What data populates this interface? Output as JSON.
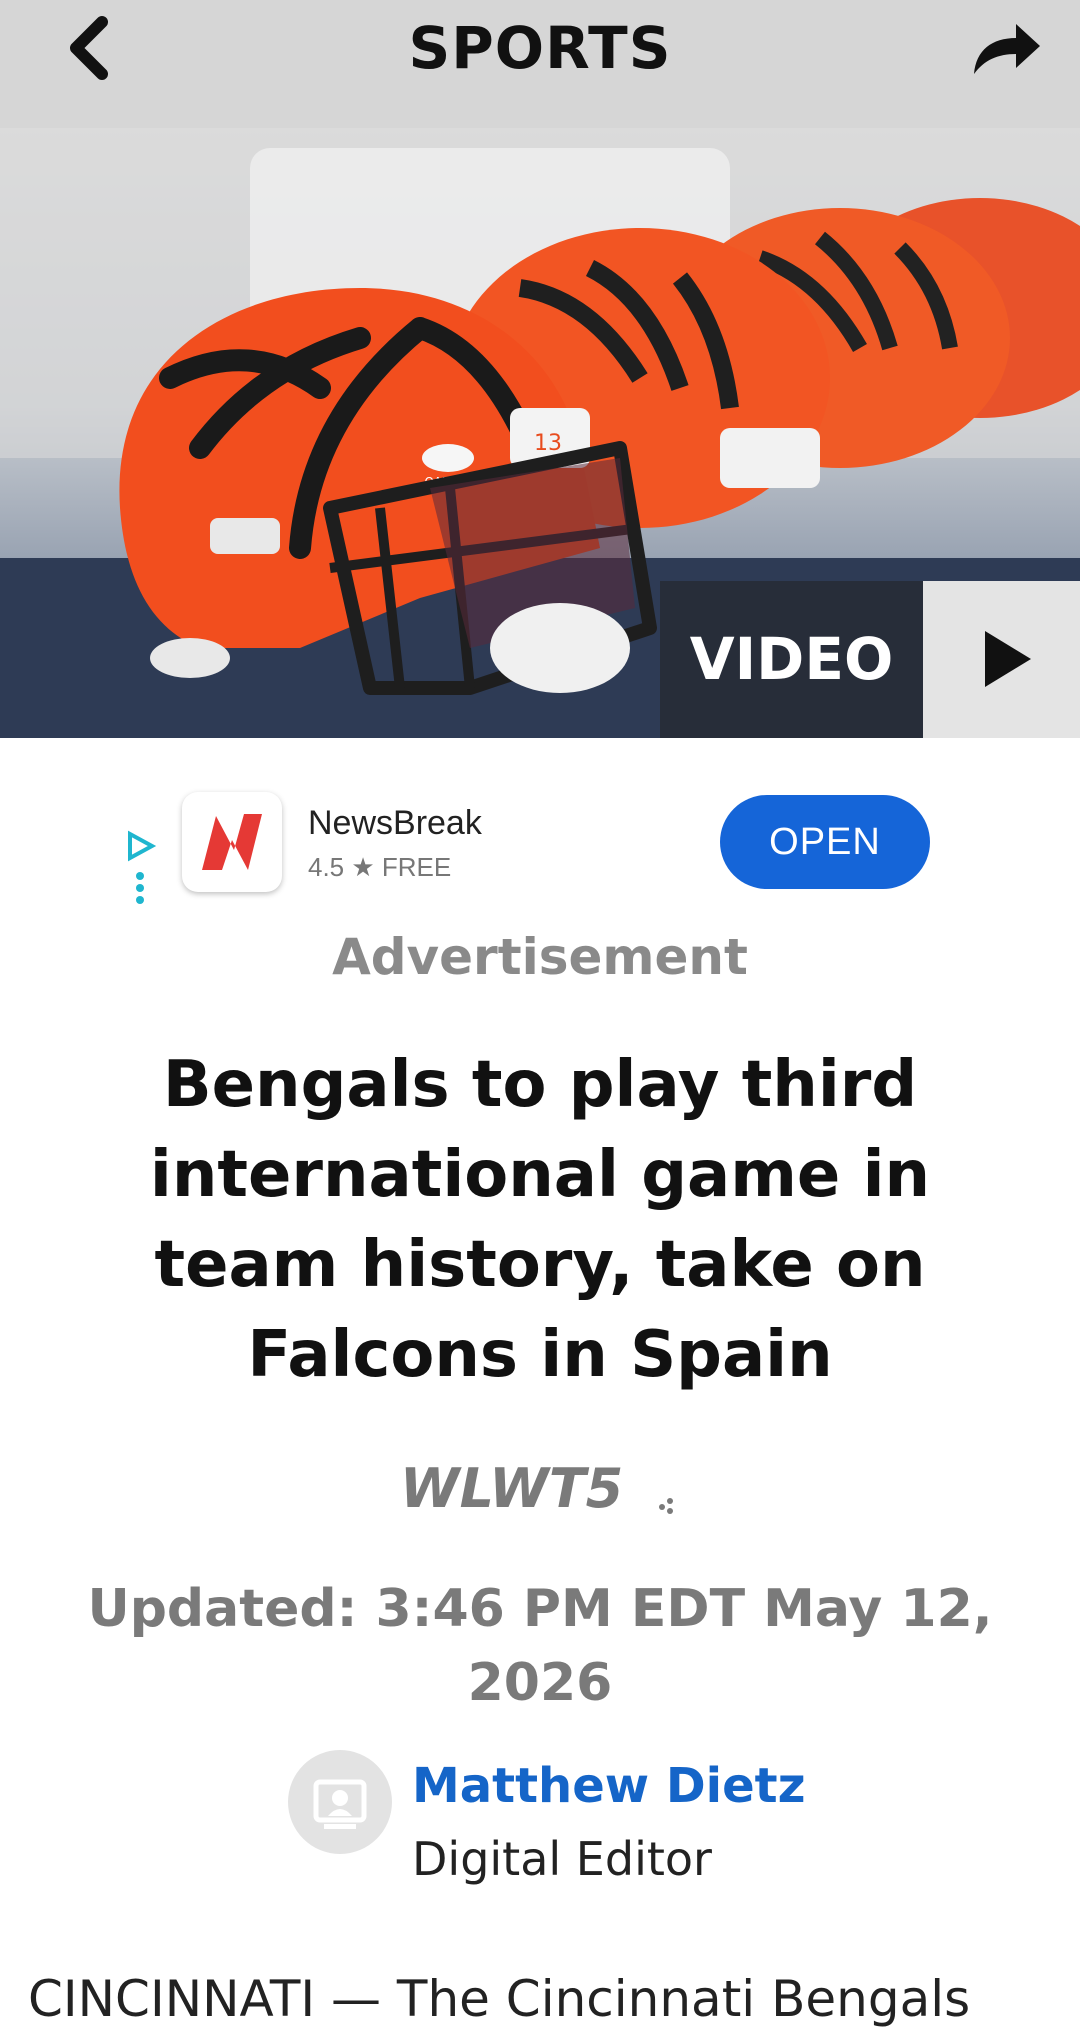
{
  "header": {
    "title": "SPORTS",
    "back_icon": "chevron-left-icon",
    "share_icon": "share-arrow-icon"
  },
  "hero": {
    "video_label": "VIDEO",
    "play_icon": "play-icon",
    "helmet_number": "13",
    "helmet_brand": "OAKLEY"
  },
  "ad": {
    "app_name": "NewsBreak",
    "rating": "4.5 ★  FREE",
    "open_label": "OPEN",
    "label": "Advertisement",
    "brand_color": "#1565d8"
  },
  "article": {
    "headline": "Bengals to play third international game in team history, take on Falcons in Spain",
    "station_logo": "WLWT5",
    "updated": "Updated: 3:46 PM EDT May 12, 2026",
    "author_name": "Matthew Dietz",
    "author_title": "Digital Editor",
    "lede": "CINCINNATI — The Cincinnati Bengals"
  }
}
